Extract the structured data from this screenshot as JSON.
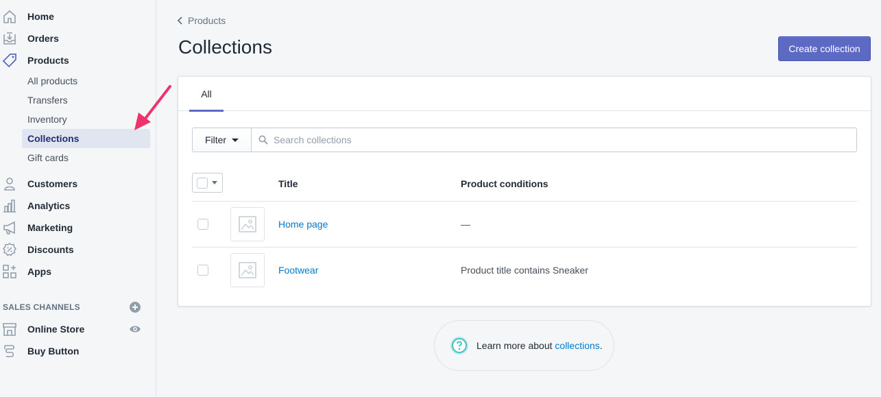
{
  "sidebar": {
    "main_items": [
      {
        "label": "Home",
        "icon": "home-icon"
      },
      {
        "label": "Orders",
        "icon": "orders-icon"
      },
      {
        "label": "Products",
        "icon": "products-tag-icon"
      }
    ],
    "product_subitems": [
      {
        "label": "All products"
      },
      {
        "label": "Transfers"
      },
      {
        "label": "Inventory"
      },
      {
        "label": "Collections",
        "active": true
      },
      {
        "label": "Gift cards"
      }
    ],
    "other_items": [
      {
        "label": "Customers",
        "icon": "customers-icon"
      },
      {
        "label": "Analytics",
        "icon": "analytics-icon"
      },
      {
        "label": "Marketing",
        "icon": "marketing-icon"
      },
      {
        "label": "Discounts",
        "icon": "discounts-icon"
      },
      {
        "label": "Apps",
        "icon": "apps-icon"
      }
    ],
    "sales_channels_title": "SALES CHANNELS",
    "channels": [
      {
        "label": "Online Store",
        "icon": "online-store-icon"
      },
      {
        "label": "Buy Button",
        "icon": "buy-button-icon"
      }
    ]
  },
  "breadcrumb": {
    "label": "Products"
  },
  "page": {
    "title": "Collections"
  },
  "actions": {
    "create_label": "Create collection"
  },
  "tabs": [
    {
      "label": "All",
      "selected": true
    }
  ],
  "filter": {
    "label": "Filter",
    "search_placeholder": "Search collections"
  },
  "table": {
    "headers": {
      "title": "Title",
      "conditions": "Product conditions"
    },
    "rows": [
      {
        "title": "Home page",
        "conditions": "—"
      },
      {
        "title": "Footwear",
        "conditions": "Product title contains Sneaker"
      }
    ]
  },
  "help": {
    "prefix": "Learn more about ",
    "link": "collections",
    "suffix": "."
  },
  "colors": {
    "accent": "#5c6ac4",
    "link": "#007ace",
    "annotation_arrow": "#f0336b",
    "help_icon": "#47c1bf"
  }
}
